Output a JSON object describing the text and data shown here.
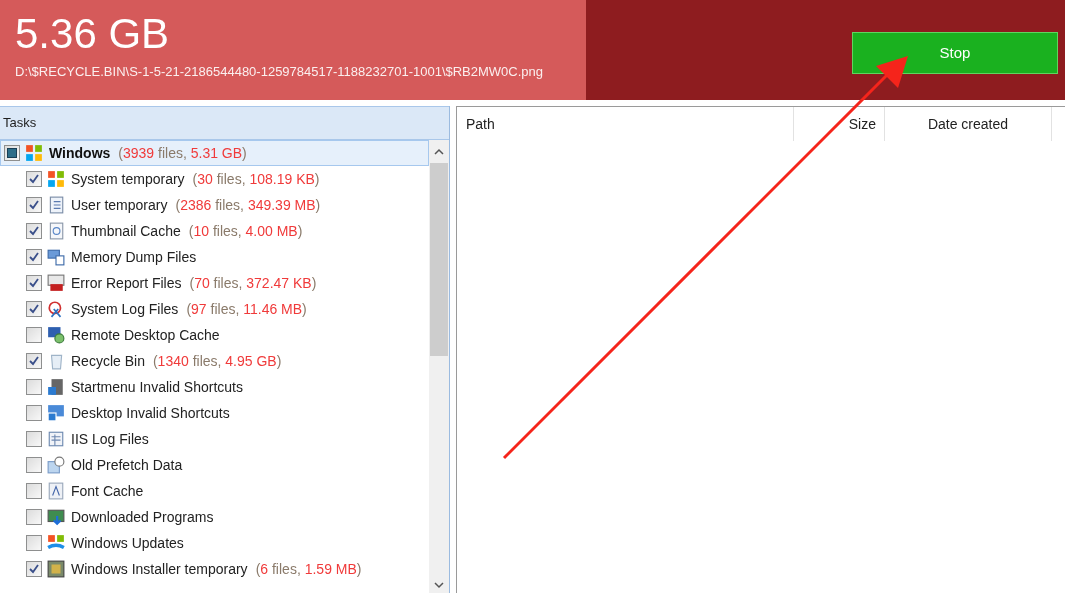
{
  "scan": {
    "total": "5.36 GB",
    "current_path": "D:\\$RECYCLE.BIN\\S-1-5-21-2186544480-1259784517-1188232701-1001\\$RB2MW0C.png",
    "level": 0.55
  },
  "stop_button": "Stop",
  "tasks": {
    "title": "Tasks",
    "root": {
      "label": "Windows",
      "indeterminate": true,
      "stats": {
        "open": "(",
        "files": "3939",
        "unit": "files,",
        "size": "5.31 GB",
        "close": ")"
      },
      "children": [
        {
          "label": "System temporary",
          "checked": true,
          "stats": {
            "open": "(",
            "files": "30",
            "unit": "files,",
            "size": "108.19 KB",
            "close": ")"
          }
        },
        {
          "label": "User temporary",
          "checked": true,
          "stats": {
            "open": "(",
            "files": "2386",
            "unit": "files,",
            "size": "349.39 MB",
            "close": ")"
          }
        },
        {
          "label": "Thumbnail Cache",
          "checked": true,
          "stats": {
            "open": "(",
            "files": "10",
            "unit": "files,",
            "size": "4.00 MB",
            "close": ")"
          }
        },
        {
          "label": "Memory Dump Files",
          "checked": true
        },
        {
          "label": "Error Report Files",
          "checked": true,
          "stats": {
            "open": "(",
            "files": "70",
            "unit": "files,",
            "size": "372.47 KB",
            "close": ")"
          }
        },
        {
          "label": "System Log Files",
          "checked": true,
          "stats": {
            "open": "(",
            "files": "97",
            "unit": "files,",
            "size": "11.46 MB",
            "close": ")"
          }
        },
        {
          "label": "Remote Desktop Cache",
          "checked": false
        },
        {
          "label": "Recycle Bin",
          "checked": true,
          "stats": {
            "open": "(",
            "files": "1340",
            "unit": "files,",
            "size": "4.95 GB",
            "close": ")"
          }
        },
        {
          "label": "Startmenu Invalid Shortcuts",
          "checked": false
        },
        {
          "label": "Desktop Invalid Shortcuts",
          "checked": false
        },
        {
          "label": "IIS Log Files",
          "checked": false
        },
        {
          "label": "Old Prefetch Data",
          "checked": false
        },
        {
          "label": "Font Cache",
          "checked": false
        },
        {
          "label": "Downloaded Programs",
          "checked": false
        },
        {
          "label": "Windows Updates",
          "checked": false
        },
        {
          "label": "Windows Installer temporary",
          "checked": true,
          "stats": {
            "open": "(",
            "files": "6",
            "unit": "files,",
            "size": "1.59 MB",
            "close": ")"
          }
        }
      ]
    }
  },
  "table": {
    "columns": [
      "Path",
      "Size",
      "Date created"
    ]
  }
}
